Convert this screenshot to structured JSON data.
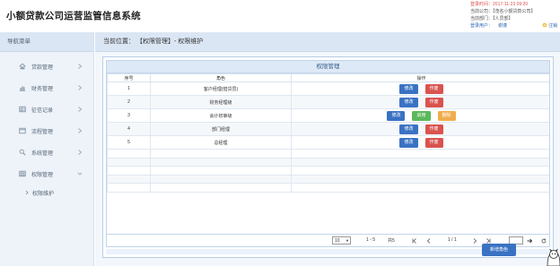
{
  "header": {
    "app_title": "小额贷款公司运营监管信息系统",
    "login_time_label": "登录时间：",
    "login_time_value": "2017-11-23 09:20",
    "company_label": "当前公司：",
    "company_value": "【茂名小额贷款公司】",
    "department_label": "当前部门：",
    "department_value": "【人员部】",
    "user_label": "登录用户：",
    "user_value": "谢谨",
    "logout_label": "注销"
  },
  "sidebar": {
    "title": "导航菜单",
    "items": [
      {
        "label": "贷款管理",
        "icon": "home-icon"
      },
      {
        "label": "财务管理",
        "icon": "bar-chart-icon"
      },
      {
        "label": "征信记录",
        "icon": "grid-icon"
      },
      {
        "label": "流程管理",
        "icon": "window-icon"
      },
      {
        "label": "系统管理",
        "icon": "search-gear-icon"
      },
      {
        "label": "权限管理",
        "icon": "table-icon"
      }
    ],
    "sub_items": [
      {
        "label": "权限维护"
      }
    ]
  },
  "breadcrumb": {
    "text": "当前位置： 【权限管理】- 权限维护"
  },
  "panel": {
    "title": "权限管理"
  },
  "table": {
    "columns": [
      "序号",
      "角色",
      "操作"
    ],
    "rows": [
      {
        "index": "1",
        "role": "客户经理(借贷员)",
        "actions": [
          "修改",
          "作废"
        ]
      },
      {
        "index": "2",
        "role": "财务经理级",
        "actions": [
          "修改",
          "作废"
        ]
      },
      {
        "index": "3",
        "role": "会计初审级",
        "actions": [
          "修改",
          "启用",
          "删除"
        ]
      },
      {
        "index": "4",
        "role": "部门经理",
        "actions": [
          "修改",
          "作废"
        ]
      },
      {
        "index": "5",
        "role": "总经理",
        "actions": [
          "修改",
          "作废"
        ]
      }
    ]
  },
  "pager": {
    "page_size": "10",
    "range": "1 - 5",
    "total": "共5",
    "page": "1 / 1",
    "page_input": ""
  },
  "buttons": {
    "add_role": "新增角色"
  },
  "colors": {
    "primary": "#3a72c3",
    "danger": "#d9534f",
    "success": "#5cb85c",
    "warning": "#f0ad4e",
    "panel_header": "#dbe6f4"
  }
}
